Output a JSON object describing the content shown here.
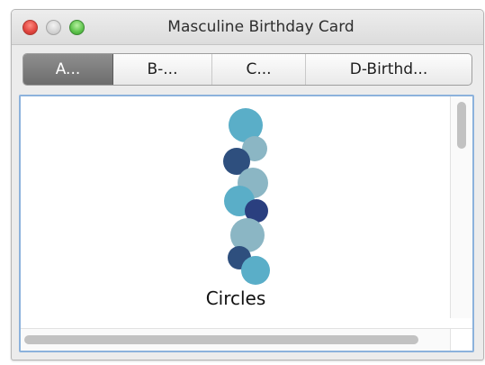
{
  "window": {
    "title": "Masculine Birthday Card"
  },
  "tabs": [
    {
      "label": "A...",
      "active": true
    },
    {
      "label": "B-...",
      "active": false
    },
    {
      "label": "C...",
      "active": false
    },
    {
      "label": "D-Birthd...",
      "active": false
    }
  ],
  "content": {
    "caption": "Circles",
    "colors": {
      "light_teal": "#5aaec8",
      "gray_blue": "#8bb6c4",
      "dark_navy": "#2e4f7e",
      "navy": "#2a3f7f",
      "selection_border": "#8cb2dc"
    }
  }
}
